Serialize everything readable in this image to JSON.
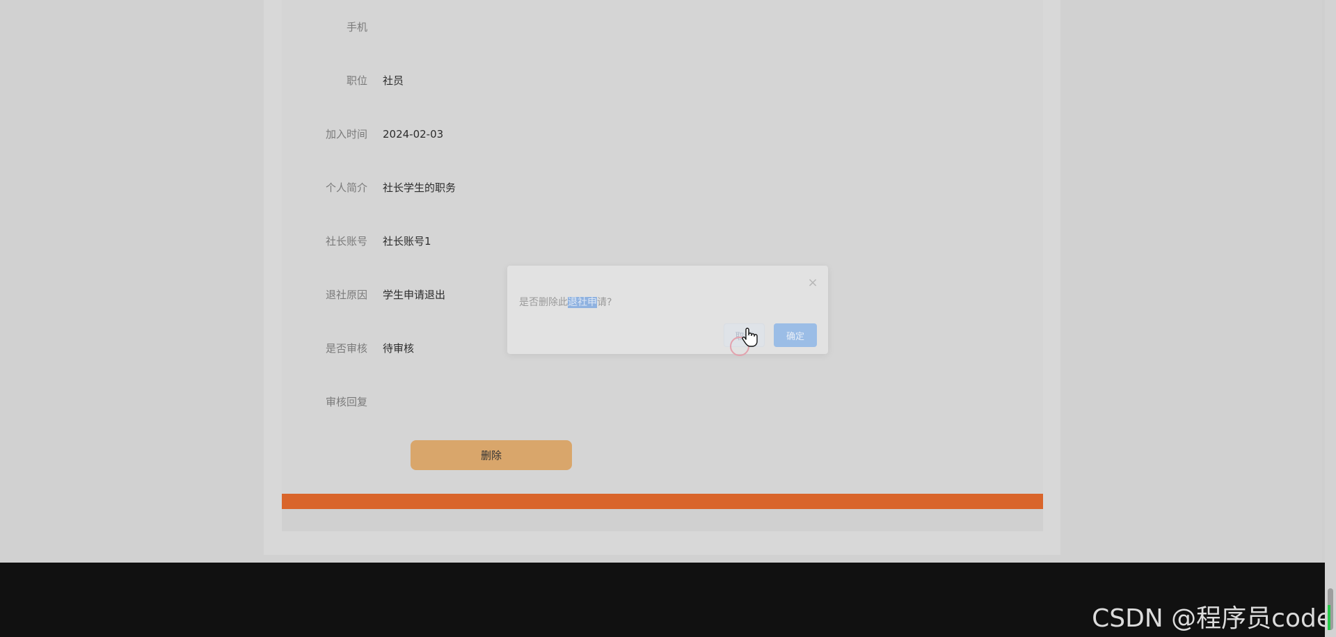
{
  "detail": {
    "fields": [
      {
        "label": "手机",
        "value": ""
      },
      {
        "label": "职位",
        "value": "社员"
      },
      {
        "label": "加入时间",
        "value": "2024-02-03"
      },
      {
        "label": "个人简介",
        "value": "社长学生的职务"
      },
      {
        "label": "社长账号",
        "value": "社长账号1"
      },
      {
        "label": "退社原因",
        "value": "学生申请退出"
      },
      {
        "label": "是否审核",
        "value": "待审核"
      },
      {
        "label": "审核回复",
        "value": ""
      }
    ],
    "delete_label": "删除"
  },
  "dialog": {
    "message_before": "是否删除此",
    "message_highlight": "退社申",
    "message_after": "请?",
    "close_glyph": "×",
    "cancel_label": "取消",
    "ok_label": "确定"
  },
  "watermark": "CSDN @程序员code",
  "colors": {
    "accent_orange": "#d9652b",
    "button_tan": "#d9a66b",
    "primary_blue": "#9bbde6"
  }
}
